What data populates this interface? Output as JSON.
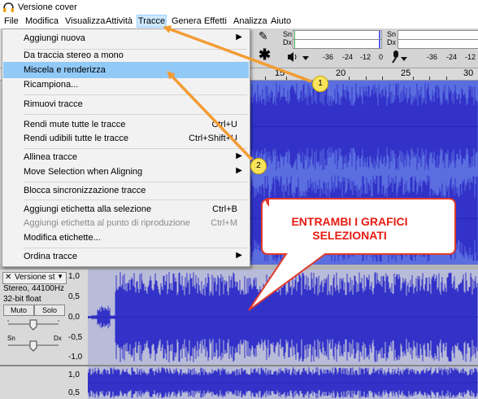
{
  "window": {
    "title": "Versione cover"
  },
  "menubar": [
    "File",
    "Modifica",
    "Visualizza",
    "Attività",
    "Tracce",
    "Genera",
    "Effetti",
    "Analizza",
    "Aiuto"
  ],
  "menu_active": "Tracce",
  "toolbar": {
    "meter_rec": {
      "top": "Sn",
      "bottom": "Dx"
    },
    "meter_play": {
      "top": "Sn",
      "bottom": "Dx"
    },
    "scale_left": [
      "-36",
      "-24",
      "-12",
      "0"
    ],
    "scale_right": [
      "-36",
      "-24",
      "-12"
    ]
  },
  "ruler": [
    "15",
    "20",
    "25",
    "30"
  ],
  "dropdown": {
    "items": [
      {
        "label": "Aggiungi nuova",
        "shortcut": "",
        "submenu": true
      },
      {
        "label": "Da traccia stereo a mono",
        "shortcut": ""
      },
      {
        "label": "Miscela e renderizza",
        "shortcut": "",
        "highlight": true
      },
      {
        "label": "Ricampiona...",
        "shortcut": ""
      },
      {
        "label": "Rimuovi tracce",
        "shortcut": ""
      },
      {
        "label": "Rendi mute tutte le tracce",
        "shortcut": "Ctrl+U"
      },
      {
        "label": "Rendi udibili tutte le tracce",
        "shortcut": "Ctrl+Shift+U"
      },
      {
        "label": "Allinea tracce",
        "shortcut": "",
        "submenu": true
      },
      {
        "label": "Move Selection when Aligning",
        "shortcut": "",
        "submenu": true
      },
      {
        "label": "Blocca sincronizzazione tracce",
        "shortcut": ""
      },
      {
        "label": "Aggiungi etichetta alla selezione",
        "shortcut": "Ctrl+B"
      },
      {
        "label": "Aggiungi etichetta al punto di riproduzione",
        "shortcut": "Ctrl+M",
        "disabled": true
      },
      {
        "label": "Modifica etichette...",
        "shortcut": ""
      },
      {
        "label": "Ordina tracce",
        "shortcut": "",
        "submenu": true
      }
    ]
  },
  "track2": {
    "name": "Versione st",
    "info1": "Stereo, 44100Hz",
    "info2": "32-bit float",
    "mute": "Muto",
    "solo": "Solo",
    "pan_left": "Sn",
    "pan_right": "Dx",
    "scale": [
      "1,0",
      "0,5",
      "0,0",
      "-0,5",
      "-1,0"
    ]
  },
  "track3": {
    "scale": [
      "1,0",
      "0,5"
    ]
  },
  "annotation": {
    "callout_line1": "ENTRAMBI I GRAFICI",
    "callout_line2": "SELEZIONATI",
    "badge1": "1",
    "badge2": "2"
  },
  "colors": {
    "accent": "#f39c34",
    "wave": "#3232c8",
    "wave_bg_selected": "#5a6ee0",
    "callout_text": "#e61b12"
  }
}
